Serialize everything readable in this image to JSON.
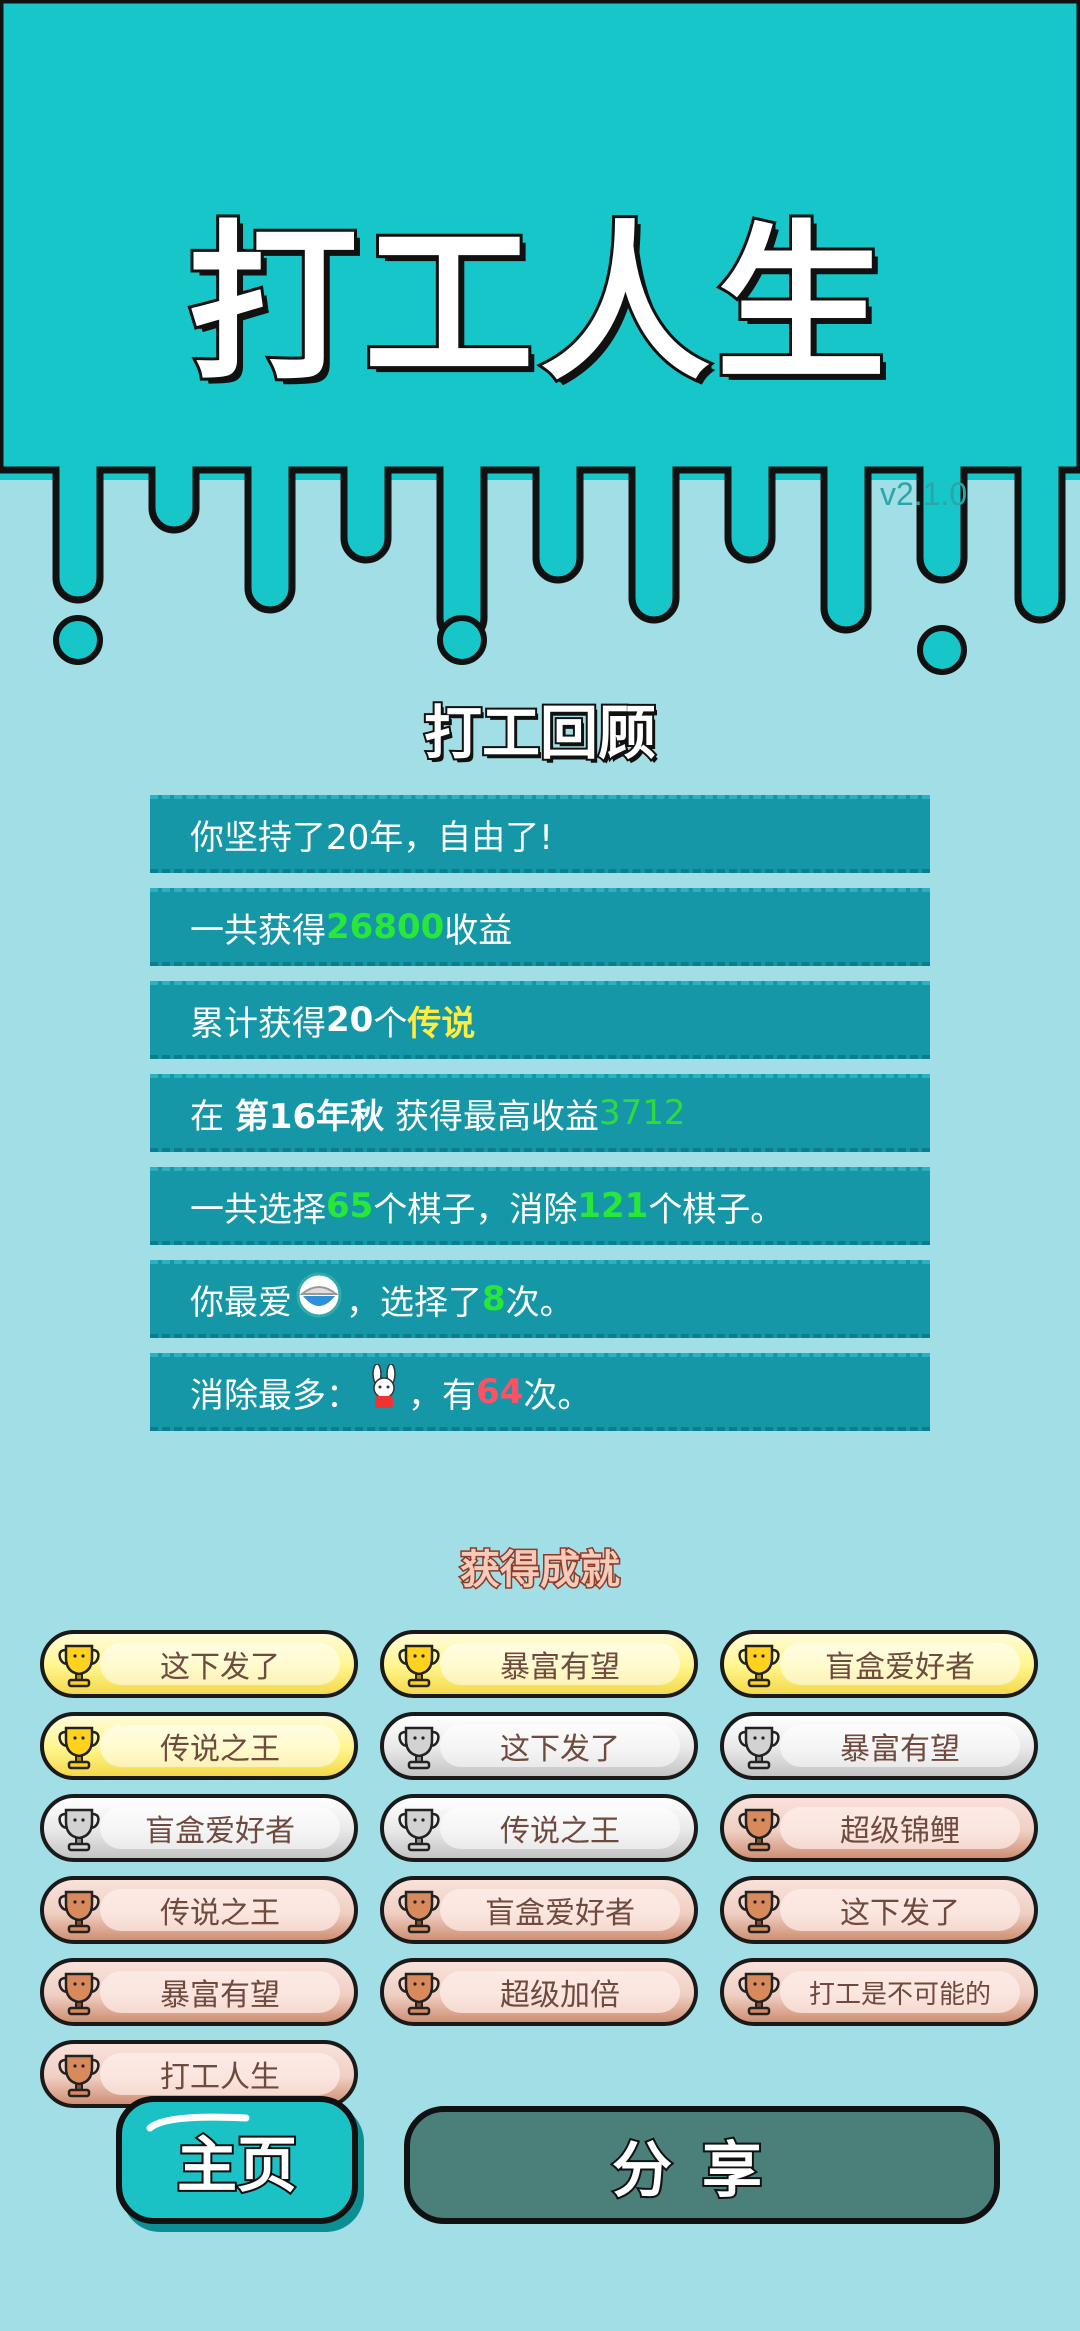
{
  "header": {
    "title": "打工人生",
    "version": "v2.1.0",
    "bg_color": "#17c6c9"
  },
  "review": {
    "title": "打工回顾",
    "rows": [
      {
        "parts": [
          {
            "t": "你坚持了20年，自由了!",
            "c": ""
          }
        ]
      },
      {
        "parts": [
          {
            "t": "一共获得",
            "c": ""
          },
          {
            "t": "26800",
            "c": "g"
          },
          {
            "t": "收益",
            "c": ""
          }
        ]
      },
      {
        "parts": [
          {
            "t": "累计获得",
            "c": ""
          },
          {
            "t": "20",
            "c": "w"
          },
          {
            "t": "个",
            "c": ""
          },
          {
            "t": "传说",
            "c": "y"
          }
        ]
      },
      {
        "parts": [
          {
            "t": "在 ",
            "c": ""
          },
          {
            "t": "第16年秋",
            "c": "w"
          },
          {
            "t": " 获得最高收益",
            "c": ""
          },
          {
            "t": "3712",
            "c": "g2"
          }
        ]
      },
      {
        "parts": [
          {
            "t": "一共选择",
            "c": ""
          },
          {
            "t": "65",
            "c": "g"
          },
          {
            "t": "个棋子，消除",
            "c": ""
          },
          {
            "t": "121",
            "c": "g"
          },
          {
            "t": "个棋子。",
            "c": ""
          }
        ]
      },
      {
        "parts": [
          {
            "t": "你最爱",
            "c": ""
          },
          {
            "icon": "rice-bowl-icon"
          },
          {
            "t": "，选择了",
            "c": ""
          },
          {
            "t": "8",
            "c": "g"
          },
          {
            "t": "次。",
            "c": ""
          }
        ]
      },
      {
        "parts": [
          {
            "t": "消除最多：",
            "c": ""
          },
          {
            "icon": "bunny-icon"
          },
          {
            "t": "，有",
            "c": ""
          },
          {
            "t": "64",
            "c": "r"
          },
          {
            "t": "次。",
            "c": ""
          }
        ]
      }
    ]
  },
  "achievements": {
    "title": "获得成就",
    "items": [
      {
        "label": "这下发了",
        "tier": "gold"
      },
      {
        "label": "暴富有望",
        "tier": "gold"
      },
      {
        "label": "盲盒爱好者",
        "tier": "gold"
      },
      {
        "label": "传说之王",
        "tier": "gold"
      },
      {
        "label": "这下发了",
        "tier": "silver"
      },
      {
        "label": "暴富有望",
        "tier": "silver"
      },
      {
        "label": "盲盒爱好者",
        "tier": "silver"
      },
      {
        "label": "传说之王",
        "tier": "silver"
      },
      {
        "label": "超级锦鲤",
        "tier": "bronze"
      },
      {
        "label": "传说之王",
        "tier": "bronze"
      },
      {
        "label": "盲盒爱好者",
        "tier": "bronze"
      },
      {
        "label": "这下发了",
        "tier": "bronze"
      },
      {
        "label": "暴富有望",
        "tier": "bronze"
      },
      {
        "label": "超级加倍",
        "tier": "bronze"
      },
      {
        "label": "打工是不可能的",
        "tier": "bronze"
      },
      {
        "label": "打工人生",
        "tier": "bronze"
      }
    ]
  },
  "buttons": {
    "home_label": "主页",
    "share_label": "分享"
  }
}
